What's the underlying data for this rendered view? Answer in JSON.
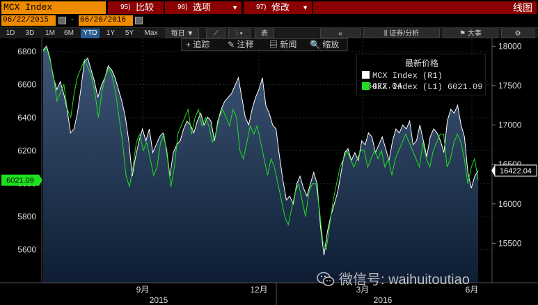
{
  "toolbar": {
    "ticker": "MCX Index",
    "menu": [
      {
        "num": "95)",
        "label": "比较"
      },
      {
        "num": "96)",
        "label": "选项"
      },
      {
        "num": "97)",
        "label": "修改"
      }
    ],
    "chart_label": "线图"
  },
  "dates": {
    "start": "06/22/2015",
    "dash": "-",
    "end": "06/20/2016"
  },
  "ranges": [
    "1D",
    "3D",
    "1M",
    "6M",
    "YTD",
    "1Y",
    "5Y",
    "Max"
  ],
  "selected_range": "YTD",
  "frequency": "每日",
  "table_label": "表",
  "right_tools": {
    "nav": "«",
    "securities": "证券/分析",
    "events": "大事",
    "settings": "⚙"
  },
  "chart_tools": [
    {
      "icon": "+",
      "label": "追踪"
    },
    {
      "icon": "✎",
      "label": "注释"
    },
    {
      "icon": "▤",
      "label": "新闻"
    },
    {
      "icon": "🔍",
      "label": "缩放"
    }
  ],
  "legend": {
    "title": "最新价格",
    "rows": [
      {
        "label": "MCX Index  (R1) 16422.04",
        "color": "#ffffff"
      },
      {
        "label": "UKX Index  (L1)  6021.09",
        "color": "#1ee01e"
      }
    ]
  },
  "watermark": "微信号: waihuitoutiao",
  "chart_data": {
    "type": "line",
    "x_ticks": [
      "9月",
      "12月",
      "3月",
      "6月"
    ],
    "year_labels": [
      "2015",
      "2016"
    ],
    "left_axis": {
      "ticks": [
        5600,
        5800,
        6000,
        6200,
        6400,
        6600,
        6800
      ],
      "range": [
        5400,
        6880
      ]
    },
    "right_axis": {
      "ticks": [
        15500,
        16000,
        16500,
        17000,
        17500,
        18000
      ],
      "range": [
        15000,
        18100
      ]
    },
    "last_values": {
      "left": "6021.09",
      "right": "16422.04"
    },
    "series": [
      {
        "name": "MCX Index",
        "axis": "right",
        "color": "#ffffff",
        "values": [
          17950,
          18000,
          17850,
          17600,
          17450,
          17550,
          17400,
          17200,
          16900,
          16950,
          17150,
          17450,
          17800,
          17850,
          17700,
          17550,
          17350,
          17500,
          17600,
          17750,
          17700,
          17600,
          17450,
          17300,
          17100,
          16800,
          16350,
          16600,
          16800,
          16950,
          16800,
          16950,
          16650,
          16750,
          16850,
          16900,
          16700,
          16350,
          16650,
          16750,
          16800,
          16950,
          17050,
          17000,
          16900,
          17050,
          17150,
          17000,
          17100,
          17050,
          16800,
          17050,
          17200,
          17300,
          17350,
          17400,
          17500,
          17600,
          17350,
          17100,
          17000,
          17200,
          17350,
          17450,
          17600,
          17250,
          17150,
          17000,
          16950,
          16600,
          16300,
          16050,
          16100,
          16000,
          16250,
          16350,
          16200,
          16100,
          16250,
          16400,
          16250,
          15700,
          15350,
          15650,
          15850,
          16000,
          16150,
          16400,
          16650,
          16700,
          16550,
          16650,
          16550,
          16800,
          16750,
          16900,
          16850,
          16650,
          16750,
          16850,
          16700,
          16550,
          16800,
          16950,
          16900,
          17000,
          16950,
          17050,
          16750,
          16800,
          17000,
          16800,
          16600,
          16850,
          16950,
          16900,
          16800,
          16650,
          17050,
          17200,
          17150,
          17250,
          17000,
          16850,
          16400,
          16200,
          16350,
          16422
        ]
      },
      {
        "name": "UKX Index",
        "axis": "left",
        "color": "#1ee01e",
        "values": [
          6800,
          6820,
          6750,
          6650,
          6500,
          6550,
          6600,
          6450,
          6400,
          6550,
          6650,
          6700,
          6750,
          6700,
          6650,
          6550,
          6400,
          6550,
          6650,
          6700,
          6650,
          6550,
          6400,
          6250,
          6050,
          5980,
          6100,
          6250,
          6300,
          6200,
          6250,
          6150,
          6050,
          6100,
          6250,
          6300,
          6150,
          5980,
          6100,
          6300,
          6350,
          6400,
          6450,
          6300,
          6400,
          6450,
          6350,
          6400,
          6350,
          6250,
          6300,
          6400,
          6450,
          6400,
          6350,
          6450,
          6400,
          6200,
          6150,
          6250,
          6350,
          6300,
          6350,
          6250,
          6150,
          6050,
          6150,
          6100,
          6000,
          5900,
          5800,
          5750,
          5850,
          5950,
          6000,
          5900,
          5800,
          5950,
          6000,
          6000,
          5850,
          5650,
          5600,
          5750,
          5900,
          6000,
          6100,
          6150,
          6200,
          6150,
          6100,
          6150,
          6200,
          6200,
          6100,
          6150,
          6200,
          6150,
          6200,
          6100,
          6150,
          6050,
          6150,
          6200,
          6250,
          6300,
          6250,
          6200,
          6150,
          6100,
          6250,
          6150,
          6100,
          6200,
          6250,
          6300,
          6300,
          6100,
          6150,
          6250,
          6300,
          6250,
          6150,
          6000,
          6100,
          6150,
          6021
        ]
      }
    ]
  }
}
